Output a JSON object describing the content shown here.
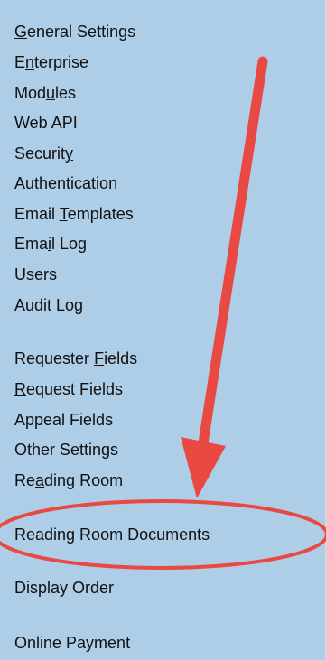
{
  "menu": {
    "items": [
      {
        "label": "General Settings",
        "accesskey_index": 0
      },
      {
        "label": "Enterprise",
        "accesskey_index": 1
      },
      {
        "label": "Modules",
        "accesskey_index": 3
      },
      {
        "label": "Web API",
        "accesskey_index": -1
      },
      {
        "label": "Security",
        "accesskey_index": 7
      },
      {
        "label": "Authentication",
        "accesskey_index": -1
      },
      {
        "label": "Email Templates",
        "accesskey_index": 6
      },
      {
        "label": "Email Log",
        "accesskey_index": 3
      },
      {
        "label": "Users",
        "accesskey_index": -1
      },
      {
        "label": "Audit Log",
        "accesskey_index": -1
      },
      {
        "label": "Requester Fields",
        "accesskey_index": 10
      },
      {
        "label": "Request Fields",
        "accesskey_index": 0
      },
      {
        "label": "Appeal Fields",
        "accesskey_index": -1
      },
      {
        "label": "Other Settings",
        "accesskey_index": -1
      },
      {
        "label": "Reading Room",
        "accesskey_index": 2
      },
      {
        "label": "Reading Room Documents",
        "accesskey_index": -1
      },
      {
        "label": "Display Order",
        "accesskey_index": -1
      },
      {
        "label": "Online Payment",
        "accesskey_index": -1
      }
    ]
  },
  "annotation": {
    "color": "#e84a43"
  }
}
